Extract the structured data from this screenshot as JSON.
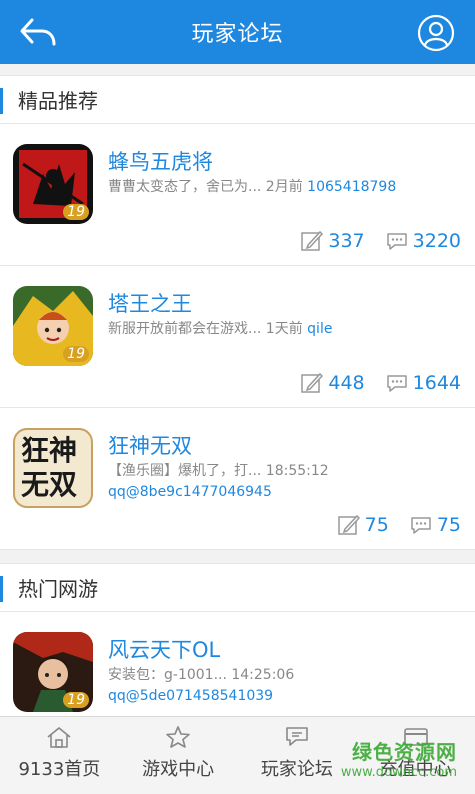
{
  "header": {
    "title": "玩家论坛"
  },
  "sections": [
    {
      "title": "精品推荐"
    },
    {
      "title": "热门网游"
    }
  ],
  "items": [
    {
      "name": "蜂鸟五虎将",
      "desc_text": "曹曹太变态了，舍已为... 2月前 ",
      "desc_user": "1065418798",
      "posts": "337",
      "replies": "3220",
      "badge": "19"
    },
    {
      "name": "塔王之王",
      "desc_text": "新服开放前都会在游戏... 1天前 ",
      "desc_user": "qile",
      "posts": "448",
      "replies": "1644",
      "badge": "19"
    },
    {
      "name": "狂神无双",
      "desc_text": "【渔乐圈】爆机了，打... 18:55:12",
      "desc_user": "qq@8be9c1477046945",
      "posts": "75",
      "replies": "75",
      "icon_text": "狂神无双"
    },
    {
      "name": "风云天下OL",
      "desc_text": "安装包：g-1001... 14:25:06",
      "desc_user": "qq@5de071458541039",
      "badge": "19"
    }
  ],
  "nav": [
    {
      "label": "9133首页",
      "icon": "home-icon"
    },
    {
      "label": "游戏中心",
      "icon": "star-icon"
    },
    {
      "label": "玩家论坛",
      "icon": "chat-icon"
    },
    {
      "label": "充值中心",
      "icon": "card-icon"
    }
  ],
  "watermark": {
    "line1": "绿色资源网",
    "line2": "www.downcc.com"
  },
  "colors": {
    "accent": "#1e88e0",
    "text_gray": "#888888",
    "watermark": "#3aa935"
  }
}
